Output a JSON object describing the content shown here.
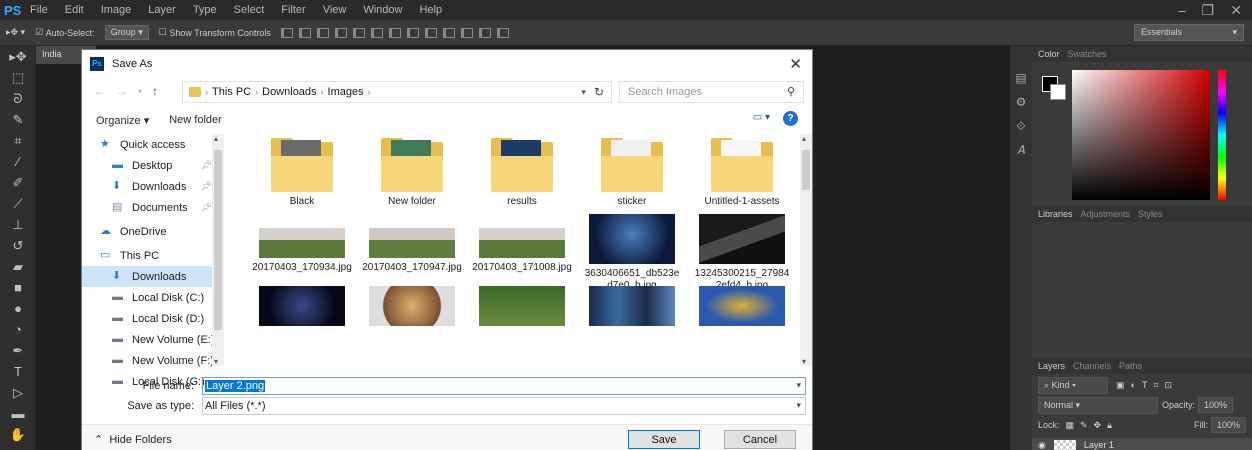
{
  "app": {
    "logo": "PS",
    "menu": [
      "File",
      "Edit",
      "Image",
      "Layer",
      "Type",
      "Select",
      "Filter",
      "View",
      "Window",
      "Help"
    ],
    "options": {
      "auto_select_label": "Auto-Select:",
      "group_value": "Group",
      "show_transform_label": "Show Transform Controls",
      "workspace": "Essentials"
    },
    "doc_tab": "India"
  },
  "tools": [
    "move-tool",
    "marquee-tool",
    "lasso-tool",
    "quick-select-tool",
    "crop-tool",
    "eyedropper-tool",
    "healing-tool",
    "brush-tool",
    "stamp-tool",
    "history-brush-tool",
    "eraser-tool",
    "gradient-tool",
    "blur-tool",
    "dodge-tool",
    "pen-tool",
    "type-tool",
    "path-select-tool",
    "shape-tool",
    "hand-tool"
  ],
  "panels": {
    "color_tabs": [
      "Color",
      "Swatches"
    ],
    "library_tabs": [
      "Libraries",
      "Adjustments",
      "Styles"
    ],
    "layers_tabs": [
      "Layers",
      "Channels",
      "Paths"
    ],
    "kind_label": "Kind",
    "blend_mode": "Normal",
    "opacity_label": "Opacity:",
    "opacity_value": "100%",
    "lock_label": "Lock:",
    "fill_label": "Fill:",
    "fill_value": "100%",
    "layer_name": "Layer 1"
  },
  "dialog": {
    "title": "Save As",
    "breadcrumb": [
      "This PC",
      "Downloads",
      "Images"
    ],
    "search_placeholder": "Search Images",
    "organize": "Organize ▾",
    "new_folder": "New folder",
    "nav_items": [
      {
        "label": "Quick access",
        "icon": "star-icon",
        "pinned": false
      },
      {
        "label": "Desktop",
        "icon": "desktop-icon",
        "pinned": true
      },
      {
        "label": "Downloads",
        "icon": "download-arrow-icon",
        "pinned": true
      },
      {
        "label": "Documents",
        "icon": "document-icon",
        "pinned": true
      },
      {
        "label": "OneDrive",
        "icon": "cloud-icon",
        "pinned": false
      },
      {
        "label": "This PC",
        "icon": "computer-icon",
        "pinned": false
      },
      {
        "label": "Downloads",
        "icon": "download-arrow-icon",
        "pinned": false
      },
      {
        "label": "Local Disk (C:)",
        "icon": "drive-icon",
        "pinned": false
      },
      {
        "label": "Local Disk (D:)",
        "icon": "drive-icon",
        "pinned": false
      },
      {
        "label": "New Volume (E:)",
        "icon": "drive-icon",
        "pinned": false
      },
      {
        "label": "New Volume (F:)",
        "icon": "drive-icon",
        "pinned": false
      },
      {
        "label": "Local Disk (G:)",
        "icon": "drive-icon",
        "pinned": false
      }
    ],
    "files": [
      {
        "label": "Black",
        "kind": "folder"
      },
      {
        "label": "New folder",
        "kind": "folder"
      },
      {
        "label": "results",
        "kind": "folder"
      },
      {
        "label": "sticker",
        "kind": "folder"
      },
      {
        "label": "Untitled-1-assets",
        "kind": "folder"
      },
      {
        "label": "20170403_170934.jpg",
        "kind": "image"
      },
      {
        "label": "20170403_170947.jpg",
        "kind": "image"
      },
      {
        "label": "20170403_171008.jpg",
        "kind": "image"
      },
      {
        "label": "3630406651_db523ed7e0_b.jpg",
        "kind": "image"
      },
      {
        "label": "13245300215_279842efd4_b.jpg",
        "kind": "image"
      },
      {
        "label": "",
        "kind": "image"
      },
      {
        "label": "",
        "kind": "image"
      },
      {
        "label": "",
        "kind": "image"
      },
      {
        "label": "",
        "kind": "image"
      },
      {
        "label": "",
        "kind": "image"
      }
    ],
    "file_name_label": "File name:",
    "file_name_value": "Layer 2.png",
    "save_type_label": "Save as type:",
    "save_type_value": "All Files (*.*)",
    "hide_folders": "Hide Folders",
    "save_button": "Save",
    "cancel_button": "Cancel"
  },
  "colors": {
    "accent": "#0078d7",
    "ps_blue": "#31a8ff",
    "folder": "#e7bd4e"
  }
}
